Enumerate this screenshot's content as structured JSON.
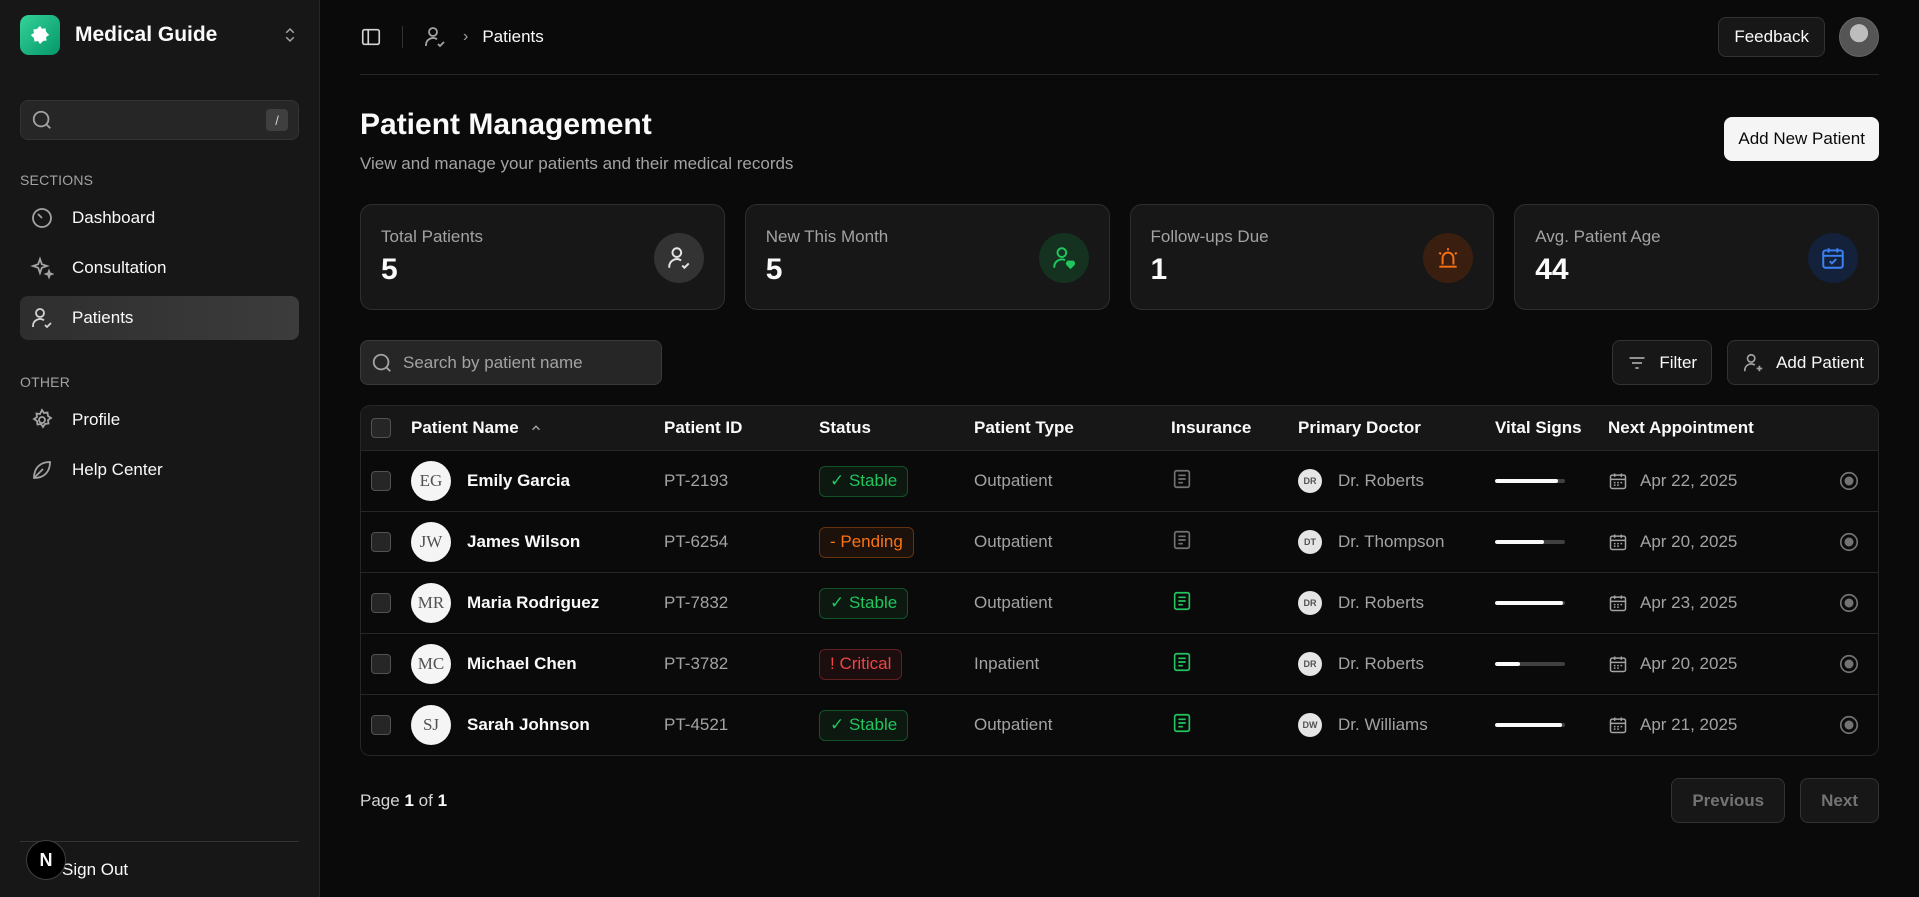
{
  "sidebar": {
    "app_name": "Medical Guide",
    "search_shortcut": "/",
    "sections_label": "SECTIONS",
    "other_label": "OTHER",
    "items": [
      {
        "label": "Dashboard",
        "icon": "gauge-icon"
      },
      {
        "label": "Consultation",
        "icon": "sparkles-icon"
      },
      {
        "label": "Patients",
        "icon": "user-check-icon",
        "active": true
      }
    ],
    "other_items": [
      {
        "label": "Profile",
        "icon": "gear-icon"
      },
      {
        "label": "Help Center",
        "icon": "leaf-icon"
      }
    ],
    "sign_out": "Sign Out",
    "badge": "N"
  },
  "topbar": {
    "breadcrumb": "Patients",
    "feedback": "Feedback"
  },
  "page": {
    "title": "Patient Management",
    "subtitle": "View and manage your patients and their medical records",
    "add_new": "Add New Patient"
  },
  "stats": [
    {
      "label": "Total Patients",
      "value": "5",
      "color": "#e5e5e5"
    },
    {
      "label": "New This Month",
      "value": "5",
      "color": "#22c55e"
    },
    {
      "label": "Follow-ups Due",
      "value": "1",
      "color": "#f97316"
    },
    {
      "label": "Avg. Patient Age",
      "value": "44",
      "color": "#3b82f6"
    }
  ],
  "toolbar": {
    "search_placeholder": "Search by patient name",
    "filter": "Filter",
    "add_patient": "Add Patient"
  },
  "table": {
    "headers": [
      "Patient Name",
      "Patient ID",
      "Status",
      "Patient Type",
      "Insurance",
      "Primary Doctor",
      "Vital Signs",
      "Next Appointment"
    ],
    "rows": [
      {
        "initials": "EG",
        "name": "Emily Garcia",
        "id": "PT-2193",
        "status": "✓ Stable",
        "status_color": "#22c55e",
        "type": "Outpatient",
        "insured": false,
        "doc_initials": "DR",
        "doctor": "Dr. Roberts",
        "vitals": 0.9,
        "appointment": "Apr 22, 2025"
      },
      {
        "initials": "JW",
        "name": "James Wilson",
        "id": "PT-6254",
        "status": "- Pending",
        "status_color": "#f97316",
        "type": "Outpatient",
        "insured": false,
        "doc_initials": "DT",
        "doctor": "Dr. Thompson",
        "vitals": 0.7,
        "appointment": "Apr 20, 2025"
      },
      {
        "initials": "MR",
        "name": "Maria Rodriguez",
        "id": "PT-7832",
        "status": "✓ Stable",
        "status_color": "#22c55e",
        "type": "Outpatient",
        "insured": true,
        "doc_initials": "DR",
        "doctor": "Dr. Roberts",
        "vitals": 0.97,
        "appointment": "Apr 23, 2025"
      },
      {
        "initials": "MC",
        "name": "Michael Chen",
        "id": "PT-3782",
        "status": "! Critical",
        "status_color": "#ef4444",
        "type": "Inpatient",
        "insured": true,
        "doc_initials": "DR",
        "doctor": "Dr. Roberts",
        "vitals": 0.35,
        "appointment": "Apr 20, 2025"
      },
      {
        "initials": "SJ",
        "name": "Sarah Johnson",
        "id": "PT-4521",
        "status": "✓ Stable",
        "status_color": "#22c55e",
        "type": "Outpatient",
        "insured": true,
        "doc_initials": "DW",
        "doctor": "Dr. Williams",
        "vitals": 0.95,
        "appointment": "Apr 21, 2025"
      }
    ]
  },
  "pager": {
    "page_label": "Page",
    "current": "1",
    "of_label": "of",
    "total": "1",
    "previous": "Previous",
    "next": "Next"
  }
}
